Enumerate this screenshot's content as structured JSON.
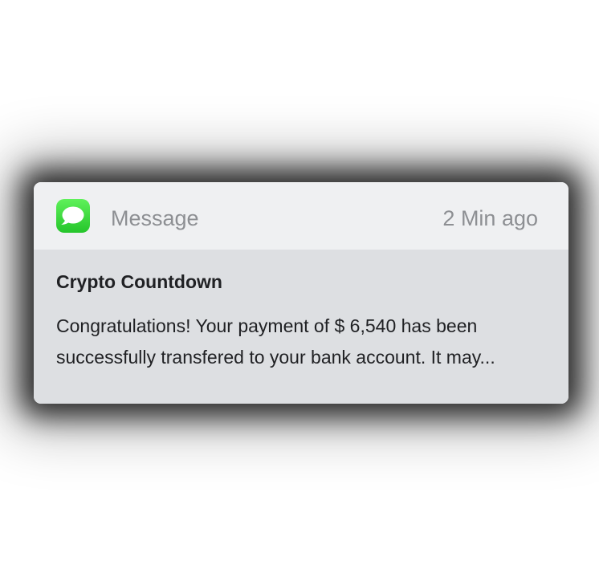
{
  "notification": {
    "app_icon": "messages-icon",
    "app_name": "Message",
    "timestamp": "2 Min ago",
    "title": "Crypto Countdown",
    "message": "Congratulations! Your payment of $ 6,540  has been successfully transfered to your bank account. It may..."
  },
  "colors": {
    "header_background": "#eff0f2",
    "body_background": "#dddfe2",
    "icon_green": "#34c94a",
    "secondary_text": "#8d8f93",
    "primary_text": "#202124"
  }
}
